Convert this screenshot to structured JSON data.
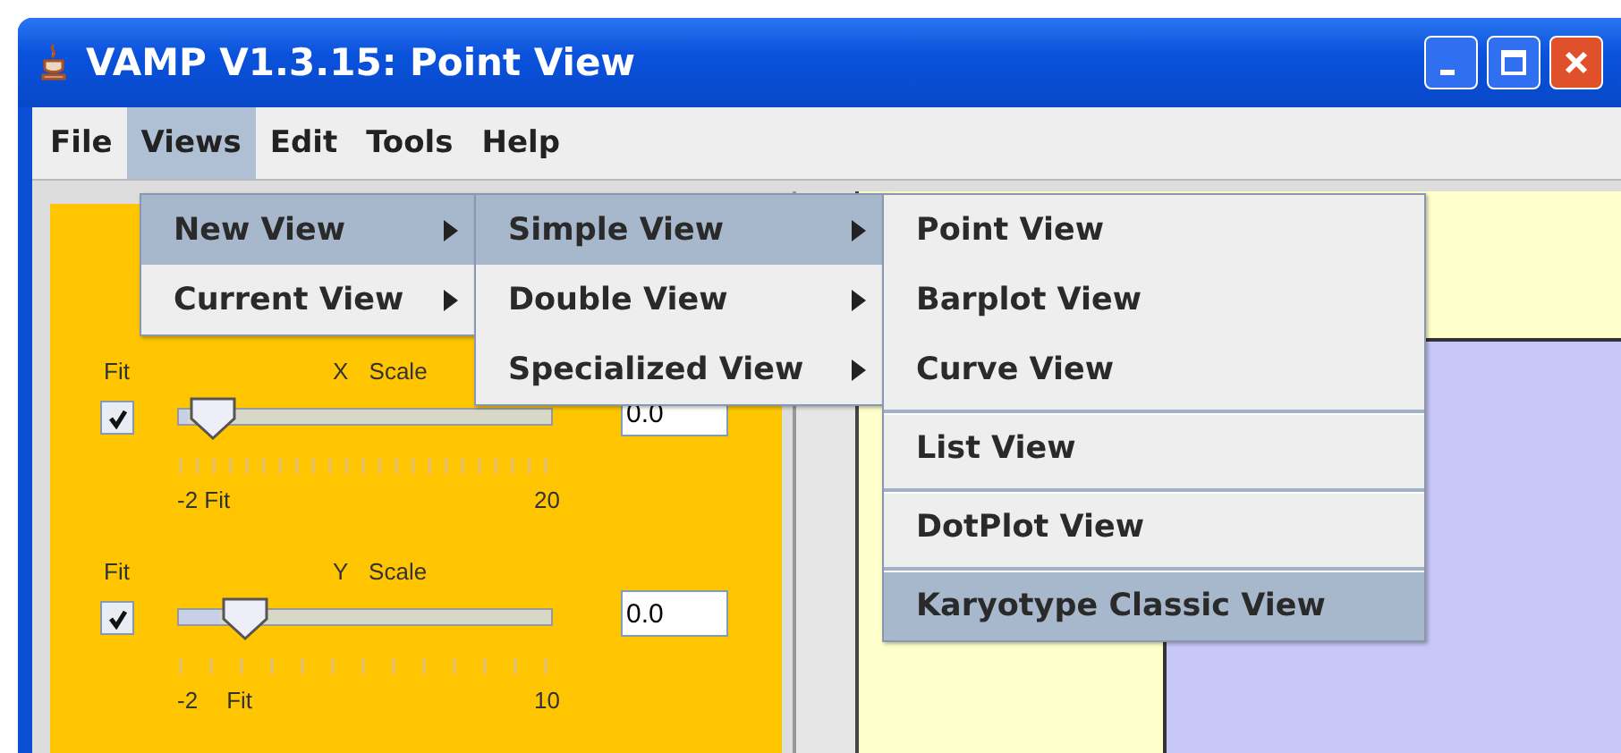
{
  "window": {
    "title": "VAMP V1.3.15: Point View"
  },
  "menubar": [
    {
      "label": "File",
      "selected": false
    },
    {
      "label": "Views",
      "selected": true
    },
    {
      "label": "Edit",
      "selected": false
    },
    {
      "label": "Tools",
      "selected": false
    },
    {
      "label": "Help",
      "selected": false
    }
  ],
  "menus": [
    {
      "items": [
        {
          "label": "New View",
          "selected": true,
          "submenu": true,
          "separator_before": false
        },
        {
          "label": "Current View",
          "selected": false,
          "submenu": true,
          "separator_before": false
        }
      ]
    },
    {
      "items": [
        {
          "label": "Simple View",
          "selected": true,
          "submenu": true,
          "separator_before": false
        },
        {
          "label": "Double View",
          "selected": false,
          "submenu": true,
          "separator_before": false
        },
        {
          "label": "Specialized View",
          "selected": false,
          "submenu": true,
          "separator_before": false
        }
      ]
    },
    {
      "items": [
        {
          "label": "Point View",
          "selected": false,
          "submenu": false,
          "separator_before": false
        },
        {
          "label": "Barplot View",
          "selected": false,
          "submenu": false,
          "separator_before": false
        },
        {
          "label": "Curve View",
          "selected": false,
          "submenu": false,
          "separator_before": false
        },
        {
          "label": "List View",
          "selected": false,
          "submenu": false,
          "separator_before": true
        },
        {
          "label": "DotPlot View",
          "selected": false,
          "submenu": false,
          "separator_before": true
        },
        {
          "label": "Karyotype Classic View",
          "selected": true,
          "submenu": false,
          "separator_before": true
        }
      ]
    }
  ],
  "panel": {
    "sliders": [
      {
        "fit_label": "Fit",
        "title": "X Scale",
        "checked": true,
        "level": 0.09,
        "value": "0.0",
        "min_labels": [
          "-2 Fit"
        ],
        "max_label": "20"
      },
      {
        "fit_label": "Fit",
        "title": "Y Scale",
        "checked": true,
        "level": 0.18,
        "value": "0.0",
        "min_labels": [
          "-2",
          "Fit"
        ],
        "max_label": "10"
      }
    ]
  }
}
